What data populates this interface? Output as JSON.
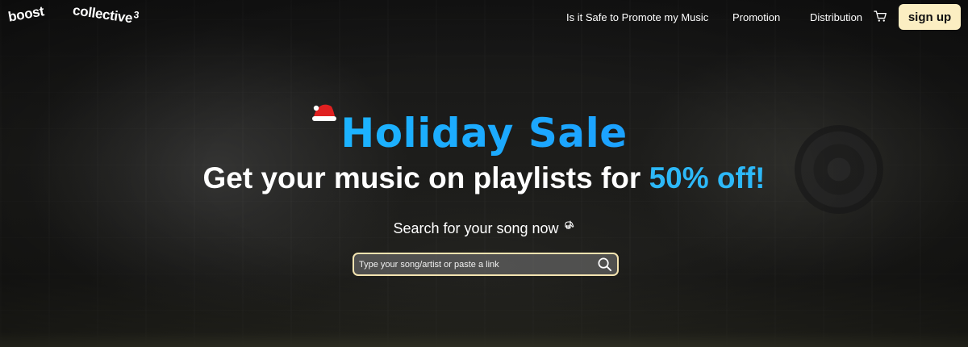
{
  "header": {
    "logo_left": "boost",
    "logo_right": "collective",
    "logo_right_mark": "3",
    "nav": [
      {
        "label": "Is it Safe to Promote my Music"
      },
      {
        "label": "Promotion"
      },
      {
        "label": "Distribution"
      }
    ],
    "cart_icon": "cart-icon",
    "signup_label": "sign up"
  },
  "hero": {
    "title": "Holiday Sale",
    "subtitle_main": "Get your music on playlists for ",
    "subtitle_highlight": "50% off!",
    "search_prompt": "Search for your song now",
    "search_placeholder": "Type your song/artist or paste a link",
    "search_value": ""
  },
  "colors": {
    "title_gradient_start": "#1ec9ff",
    "title_gradient_end": "#1a8cff",
    "highlight": "#2db8f8",
    "signup_bg": "#fbeec2",
    "search_border": "#f3e3b0"
  }
}
